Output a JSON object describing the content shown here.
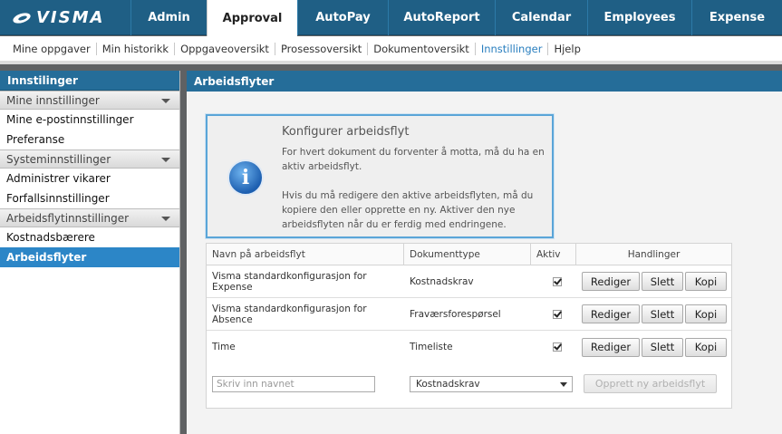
{
  "brand": {
    "logo_text": "VISMA"
  },
  "top_tabs": [
    {
      "label": "Admin"
    },
    {
      "label": "Approval"
    },
    {
      "label": "AutoPay"
    },
    {
      "label": "AutoReport"
    },
    {
      "label": "Calendar"
    },
    {
      "label": "Employees"
    },
    {
      "label": "Expense"
    }
  ],
  "sub_tabs": [
    {
      "label": "Mine oppgaver"
    },
    {
      "label": "Min historikk"
    },
    {
      "label": "Oppgaveoversikt"
    },
    {
      "label": "Prosessoversikt"
    },
    {
      "label": "Dokumentoversikt"
    },
    {
      "label": "Innstillinger"
    },
    {
      "label": "Hjelp"
    }
  ],
  "sidebar": {
    "title": "Innstilinger",
    "groups": [
      {
        "label": "Mine innstillinger",
        "items": [
          "Mine e-postinnstillinger",
          "Preferanse"
        ]
      },
      {
        "label": "Systeminnstillinger",
        "items": [
          "Administrer vikarer",
          "Forfallsinnstillinger"
        ]
      },
      {
        "label": "Arbeidsflytinnstillinger",
        "items": [
          "Kostnadsbærere",
          "Arbeidsflyter"
        ]
      }
    ]
  },
  "main": {
    "title": "Arbeidsflyter",
    "info": {
      "title": "Konfigurer arbeidsflyt",
      "p1": "For hvert dokument du forventer å motta, må du ha en aktiv arbeidsflyt.",
      "p2": "Hvis du må redigere den aktive arbeidsflyten, må du kopiere den eller opprette en ny. Aktiver den nye arbeidsflyten når du er ferdig med endringene."
    },
    "table": {
      "headers": [
        "Navn på arbeidsflyt",
        "Dokumenttype",
        "Aktiv",
        "Handlinger"
      ],
      "rows": [
        {
          "name": "Visma standardkonfigurasjon for Expense",
          "type": "Kostnadskrav",
          "active": true
        },
        {
          "name": "Visma standardkonfigurasjon for Absence",
          "type": "Fraværsforespørsel",
          "active": true
        },
        {
          "name": "Time",
          "type": "Timeliste",
          "active": true
        }
      ],
      "actions": {
        "edit": "Rediger",
        "delete": "Slett",
        "copy": "Kopi"
      }
    },
    "new_workflow": {
      "name_placeholder": "Skriv inn navnet",
      "selected_type": "Kostnadskrav",
      "create_label": "Opprett ny arbeidsflyt"
    }
  }
}
